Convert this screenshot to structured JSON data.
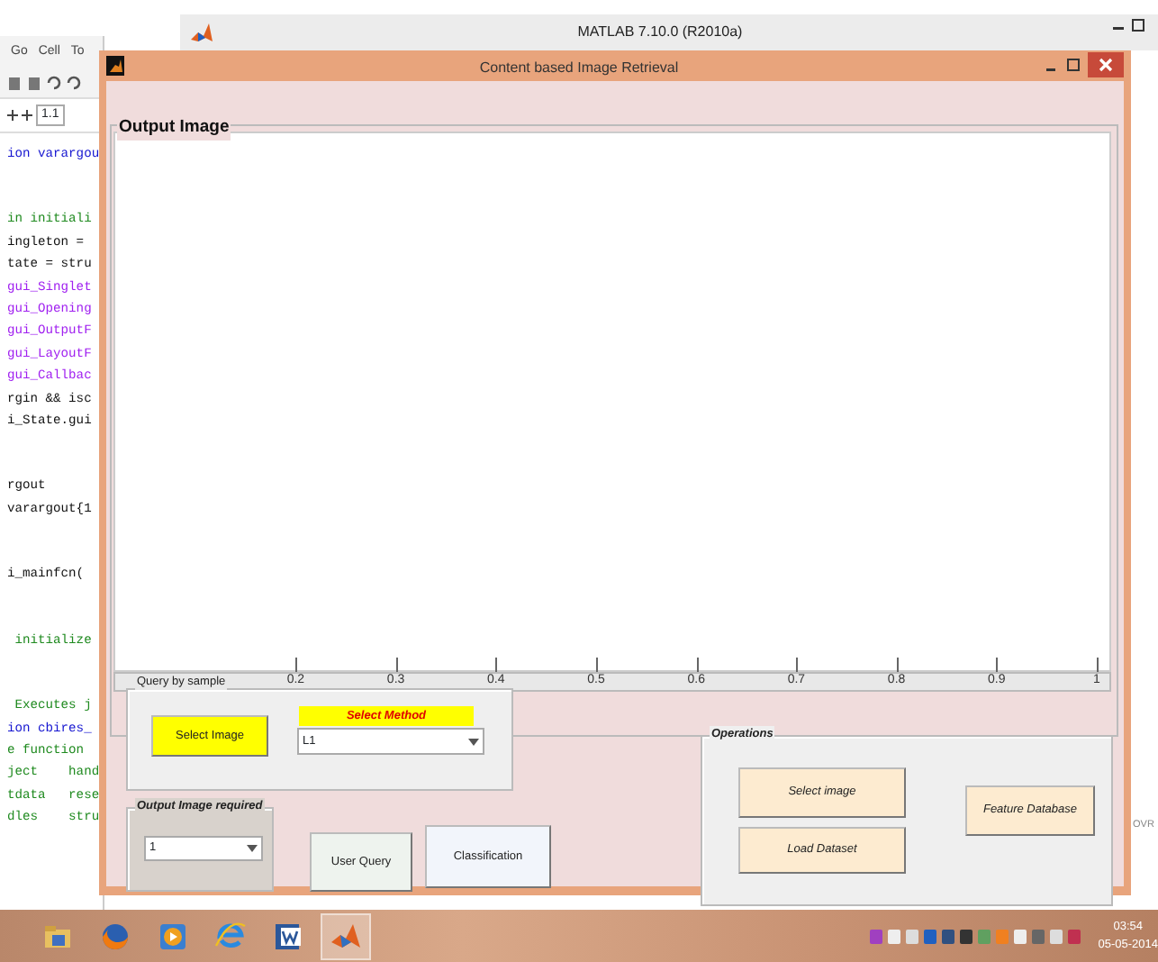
{
  "background_window": {
    "title": "MATLAB  7.10.0 (R2010a)"
  },
  "editor": {
    "menu": [
      "Go",
      "Cell",
      "To"
    ],
    "cell_field": "1.1",
    "code_blocks": [
      [
        {
          "text": "ion varargou",
          "kind": "keyword"
        }
      ],
      [
        {
          "text": "in initiali",
          "kind": "comment"
        },
        {
          "text": "ingleton = ",
          "kind": "code"
        },
        {
          "text": "tate = stru",
          "kind": "code"
        },
        {
          "text": "gui_Singlet",
          "kind": "string"
        },
        {
          "text": "gui_Opening",
          "kind": "string"
        },
        {
          "text": "gui_OutputF",
          "kind": "string"
        },
        {
          "text": "gui_LayoutF",
          "kind": "string"
        },
        {
          "text": "gui_Callbac",
          "kind": "string"
        },
        {
          "text": "rgin && isc",
          "kind": "code"
        },
        {
          "text": "i_State.gui",
          "kind": "code"
        }
      ],
      [
        {
          "text": "rgout",
          "kind": "code"
        },
        {
          "text": "varargout{1",
          "kind": "code"
        }
      ],
      [
        {
          "text": "i_mainfcn(",
          "kind": "code"
        }
      ],
      [
        {
          "text": " initialize",
          "kind": "comment"
        }
      ],
      [
        {
          "text": " Executes j",
          "kind": "comment"
        },
        {
          "text": "ion cbires_",
          "kind": "keyword"
        },
        {
          "text": "e function ",
          "kind": "comment"
        },
        {
          "text": "ject    hand",
          "kind": "comment"
        },
        {
          "text": "tdata   rese",
          "kind": "comment"
        },
        {
          "text": "dles    stru",
          "kind": "comment"
        }
      ]
    ]
  },
  "dialog": {
    "title": "Content based Image Retrieval",
    "output_panel": {
      "title": "Output Image",
      "axis_ticks": [
        "0.2",
        "0.3",
        "0.4",
        "0.5",
        "0.6",
        "0.7",
        "0.8",
        "0.9",
        "1"
      ]
    },
    "query_panel": {
      "title": "Query by sample",
      "select_button": "Select Image",
      "method_label": "Select Method",
      "method_value": "L1"
    },
    "required_panel": {
      "title": "Output Image  required",
      "value": "1"
    },
    "buttons": [
      "User Query",
      "Classification"
    ],
    "operations_panel": {
      "title": "Operations",
      "buttons": [
        "Select image",
        "Load Dataset",
        "Feature Database"
      ]
    }
  },
  "status": "OVR",
  "taskbar": {
    "apps": [
      {
        "kind": "explorer",
        "selected": false
      },
      {
        "kind": "firefox",
        "selected": false
      },
      {
        "kind": "media",
        "selected": false
      },
      {
        "kind": "ie",
        "selected": false
      },
      {
        "kind": "word",
        "selected": false
      },
      {
        "kind": "matlab",
        "selected": true
      }
    ],
    "time": "03:54",
    "date": "05-05-2014"
  }
}
